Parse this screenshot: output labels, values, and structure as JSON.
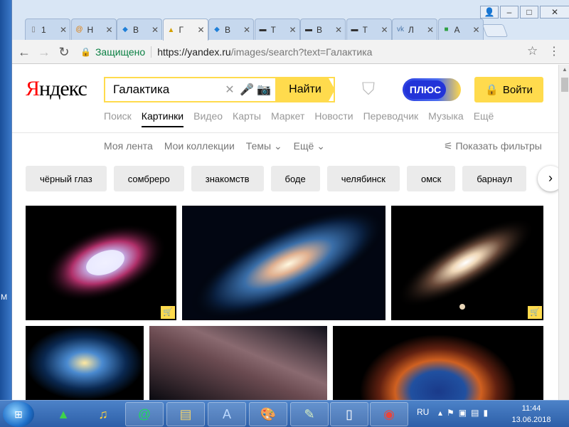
{
  "browser": {
    "tabs": [
      {
        "title": "1",
        "icon": "document-icon",
        "active": false
      },
      {
        "title": "Н",
        "icon": "at-sign-icon",
        "active": false
      },
      {
        "title": "В",
        "icon": "app-icon",
        "active": false
      },
      {
        "title": "Г",
        "icon": "image-icon",
        "active": true
      },
      {
        "title": "В",
        "icon": "app-icon",
        "active": false
      },
      {
        "title": "Т",
        "icon": "window-icon",
        "active": false
      },
      {
        "title": "В",
        "icon": "window-icon",
        "active": false
      },
      {
        "title": "Т",
        "icon": "window-icon",
        "active": false
      },
      {
        "title": "Л",
        "icon": "vk-icon",
        "active": false
      },
      {
        "title": "А",
        "icon": "green-square-icon",
        "active": false
      }
    ],
    "window_controls": {
      "user": "👤",
      "minimize": "–",
      "maximize": "□",
      "close": "✕"
    },
    "address": {
      "secure_label": "Защищено",
      "url_host": "https://yandex.ru",
      "url_path": "/images/search?text=Галактика"
    }
  },
  "header": {
    "logo_first": "Я",
    "logo_rest": "ндекс",
    "search_value": "Галактика",
    "find_button": "Найти",
    "plus_label": "ПЛЮС",
    "login_button": "Войти"
  },
  "services": [
    "Поиск",
    "Картинки",
    "Видео",
    "Карты",
    "Маркет",
    "Новости",
    "Переводчик",
    "Музыка",
    "Ещё"
  ],
  "active_service": "Картинки",
  "subnav": {
    "feed": "Моя лента",
    "collections": "Мои коллекции",
    "themes": "Темы",
    "more": "Ещё",
    "filters": "Показать фильтры"
  },
  "chips": [
    "чёрный глаз",
    "сомбреро",
    "знакомств",
    "боде",
    "челябинск",
    "омск",
    "барнаул"
  ],
  "taskbar": {
    "lang": "RU",
    "time": "11:44",
    "date": "13.06.2018"
  },
  "desktop_label": "М"
}
